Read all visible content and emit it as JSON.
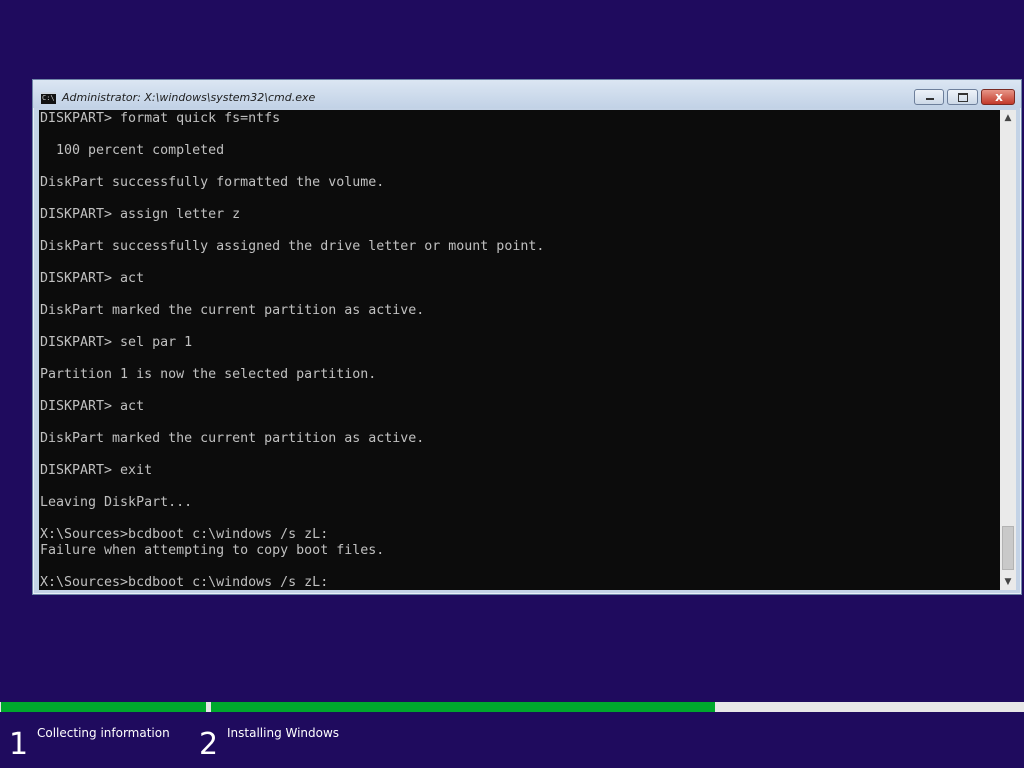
{
  "window": {
    "title": "Administrator: X:\\windows\\system32\\cmd.exe",
    "icon": "cmd-icon",
    "icon_text": "C:\\",
    "close_glyph": "x"
  },
  "console": {
    "lines": [
      "DISKPART> format quick fs=ntfs",
      "",
      "  100 percent completed",
      "",
      "DiskPart successfully formatted the volume.",
      "",
      "DISKPART> assign letter z",
      "",
      "DiskPart successfully assigned the drive letter or mount point.",
      "",
      "DISKPART> act",
      "",
      "DiskPart marked the current partition as active.",
      "",
      "DISKPART> sel par 1",
      "",
      "Partition 1 is now the selected partition.",
      "",
      "DISKPART> act",
      "",
      "DiskPart marked the current partition as active.",
      "",
      "DISKPART> exit",
      "",
      "Leaving DiskPart...",
      "",
      "X:\\Sources>bcdboot c:\\windows /s zL:",
      "Failure when attempting to copy boot files.",
      "",
      "X:\\Sources>bcdboot c:\\windows /s zL:"
    ]
  },
  "scrollbar": {
    "up_glyph": "▲",
    "down_glyph": "▼"
  },
  "setup": {
    "steps": [
      {
        "number": "1",
        "label": "Collecting information",
        "progress": 1.0
      },
      {
        "number": "2",
        "label": "Installing Windows",
        "progress": 0.62
      }
    ]
  },
  "colors": {
    "background": "#1f0b5e",
    "progress_fill": "#00a82d",
    "console_bg": "#0c0c0c",
    "console_text": "#c0c0c0"
  }
}
